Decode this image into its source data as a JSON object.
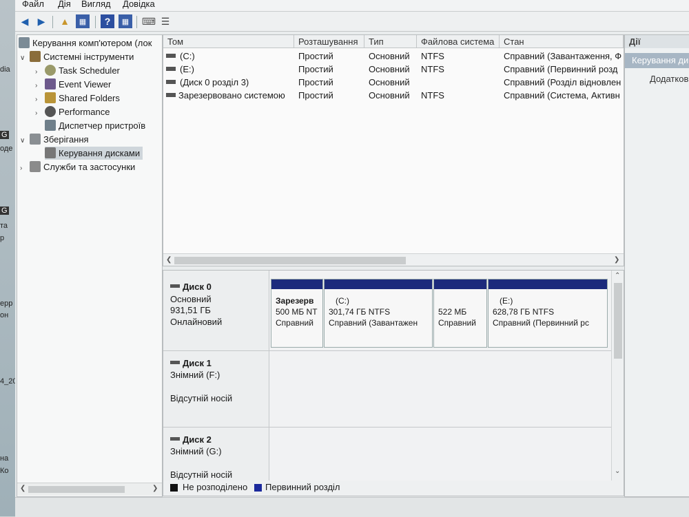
{
  "menu": [
    "Файл",
    "Дія",
    "Вигляд",
    "Довідка"
  ],
  "tree": {
    "root": "Керування комп'ютером (лок",
    "system_tools": "Системні інструменти",
    "task_scheduler": "Task Scheduler",
    "event_viewer": "Event Viewer",
    "shared_folders": "Shared Folders",
    "performance": "Performance",
    "device_manager": "Диспетчер пристроїв",
    "storage": "Зберігання",
    "disk_management": "Керування дисками",
    "services": "Служби та застосунки"
  },
  "volumes": {
    "headers": [
      "Том",
      "Розташування",
      "Тип",
      "Файлова система",
      "Стан"
    ],
    "rows": [
      {
        "name": "(C:)",
        "layout": "Простий",
        "type": "Основний",
        "fs": "NTFS",
        "status": "Справний (Завантаження, Ф"
      },
      {
        "name": "(E:)",
        "layout": "Простий",
        "type": "Основний",
        "fs": "NTFS",
        "status": "Справний (Первинний розд"
      },
      {
        "name": "(Диск 0 розділ 3)",
        "layout": "Простий",
        "type": "Основний",
        "fs": "",
        "status": "Справний (Розділ відновлен"
      },
      {
        "name": "Зарезервовано системою",
        "layout": "Простий",
        "type": "Основний",
        "fs": "NTFS",
        "status": "Справний (Система, Активн"
      }
    ]
  },
  "disks": [
    {
      "name": "Диск 0",
      "kind": "Основний",
      "size": "931,51 ГБ",
      "state": "Онлайновий",
      "partitions": [
        {
          "title": "Зарезерв",
          "size": "500 МБ NT",
          "status": "Справний"
        },
        {
          "title": "(C:)",
          "size": "301,74 ГБ NTFS",
          "status": "Справний (Завантажен"
        },
        {
          "title": "",
          "size": "522 МБ",
          "status": "Справний"
        },
        {
          "title": "(E:)",
          "size": "628,78 ГБ NTFS",
          "status": "Справний (Первинний рс"
        }
      ]
    },
    {
      "name": "Диск 1",
      "kind": "Знімний (F:)",
      "state": "Відсутній носій"
    },
    {
      "name": "Диск 2",
      "kind": "Знімний (G:)",
      "state": "Відсутній носій"
    }
  ],
  "legend": {
    "unallocated": "Не розподілено",
    "primary": "Первинний розділ"
  },
  "actions": {
    "header": "Дії",
    "section": "Керування ди",
    "more": "Додатков"
  },
  "desktop_fragments": [
    "dia",
    "G",
    "оде",
    "G",
    "та",
    "р",
    "ерр",
    "он",
    "4_20",
    "на",
    "Ко"
  ],
  "colors": {
    "partition_bar": "#1c2a7c",
    "unallocated": "#111111",
    "primary": "#1c2a9c"
  }
}
